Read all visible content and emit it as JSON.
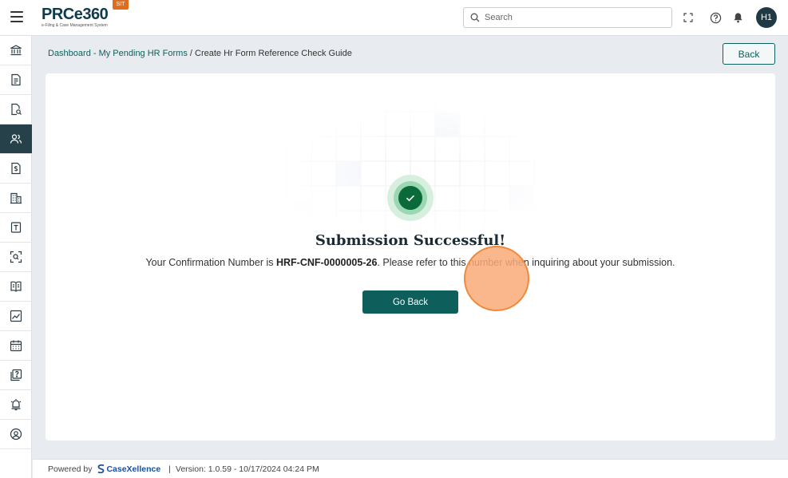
{
  "header": {
    "logo_text": "PRCe360",
    "logo_subtitle": "e-Filing & Case Management System",
    "env_badge": "SIT",
    "search_placeholder": "Search",
    "avatar_initials": "H1"
  },
  "sidebar": {
    "items": [
      {
        "name": "institution",
        "active": false
      },
      {
        "name": "document",
        "active": false
      },
      {
        "name": "document-search",
        "active": false
      },
      {
        "name": "users",
        "active": true
      },
      {
        "name": "dollar-document",
        "active": false
      },
      {
        "name": "building",
        "active": false
      },
      {
        "name": "text-document",
        "active": false
      },
      {
        "name": "scan",
        "active": false
      },
      {
        "name": "book",
        "active": false
      },
      {
        "name": "chart",
        "active": false
      },
      {
        "name": "calendar",
        "active": false
      },
      {
        "name": "help-document",
        "active": false
      },
      {
        "name": "alarm",
        "active": false
      },
      {
        "name": "user-circle",
        "active": false
      }
    ]
  },
  "breadcrumb": {
    "link": "Dashboard - My Pending HR Forms",
    "separator": " / ",
    "current": "Create Hr Form Reference Check Guide"
  },
  "back_label": "Back",
  "success": {
    "title": "Submission Successful!",
    "message_before": "Your Confirmation Number is ",
    "confirmation_number": "HRF-CNF-0000005-26",
    "message_after": ". Please refer to this number when inquiring about your submission.",
    "button_label": "Go Back"
  },
  "footer": {
    "powered_by": "Powered by",
    "brand": "CaseXellence",
    "separator": "|",
    "version": "Version: 1.0.59 - 10/17/2024 04:24 PM"
  },
  "colors": {
    "primary": "#0e5f5b",
    "success": "#0b6a3a",
    "sidebar_active": "#27414b",
    "badge": "#e06d1b"
  }
}
